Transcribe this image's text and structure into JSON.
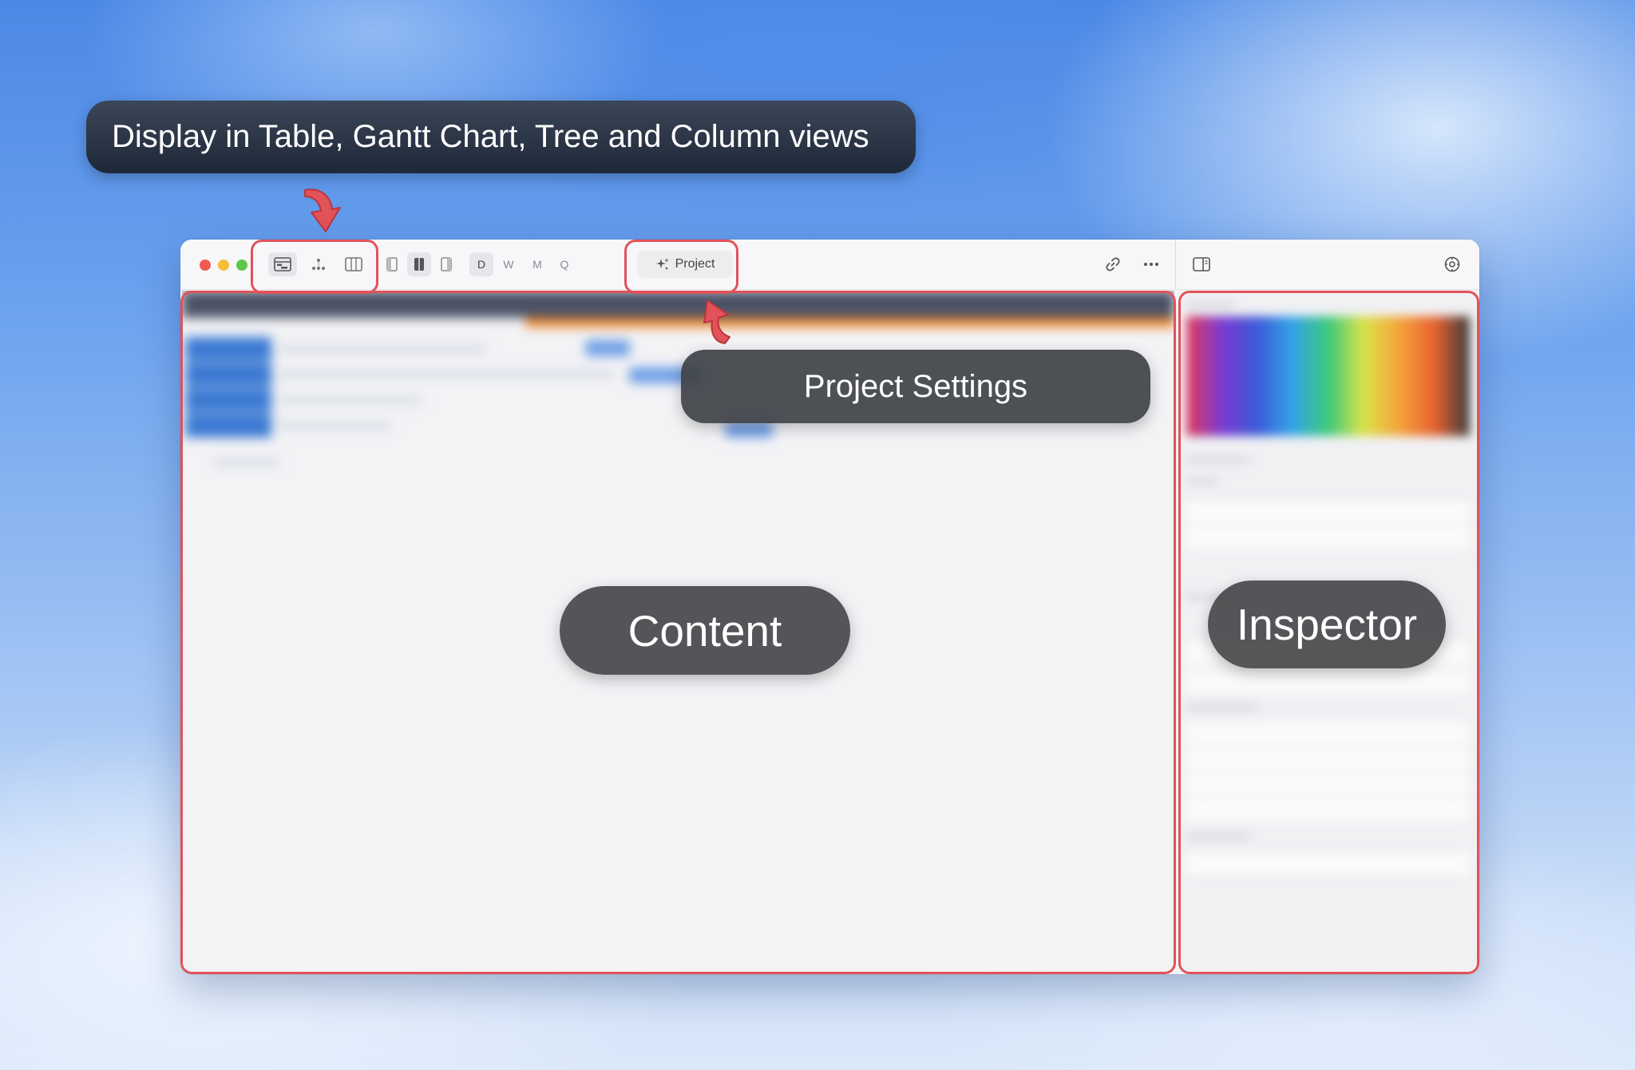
{
  "callouts": {
    "views": "Display in Table, Gantt Chart, Tree and Column views",
    "project_settings": "Project Settings",
    "content": "Content",
    "inspector": "Inspector"
  },
  "toolbar": {
    "view_modes": [
      "table-gantt-icon",
      "tree-icon",
      "columns-icon"
    ],
    "layout_modes": [
      "left-pane-icon",
      "both-panes-icon",
      "right-pane-icon"
    ],
    "timescale": [
      "D",
      "W",
      "M",
      "Q"
    ],
    "active_timescale": "D",
    "project_button": "Project",
    "link_icon": "link-icon",
    "more_icon": "ellipsis-icon"
  },
  "inspector_toolbar": {
    "toggle_icon": "sidebar-toggle-icon",
    "settings_icon": "gear-icon"
  },
  "colors": {
    "highlight": "#e25259",
    "callout_dark": "#1e2838",
    "callout_gray": "#46484a",
    "gantt_header": "#4a5266",
    "gantt_accent": "#f08a2e",
    "task_blue": "#3b7ad3"
  }
}
